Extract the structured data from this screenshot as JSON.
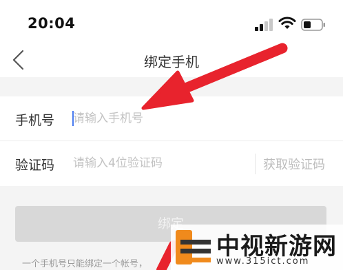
{
  "status_bar": {
    "time": "20:04",
    "signal_icon": "cellular-signal-icon",
    "wifi_icon": "wifi-icon",
    "battery_icon": "battery-icon"
  },
  "nav": {
    "back_icon": "chevron-left-icon",
    "title": "绑定手机"
  },
  "form": {
    "phone_label": "手机号",
    "phone_placeholder": "请输入手机号",
    "code_label": "验证码",
    "code_placeholder": "请输入4位验证码",
    "get_code_label": "获取验证码"
  },
  "bind_button_label": "绑定",
  "note": "一个手机号只能绑定一个帐号，",
  "watermark": {
    "title": "中视新游网",
    "url": "www.315ict.com"
  },
  "colors": {
    "arrow": "#e8232d",
    "cursor": "#4a7cf0",
    "button_disabled": "#d8d8d8",
    "page_background": "#f4f4f4",
    "logo_orange": "#f08a1c"
  }
}
